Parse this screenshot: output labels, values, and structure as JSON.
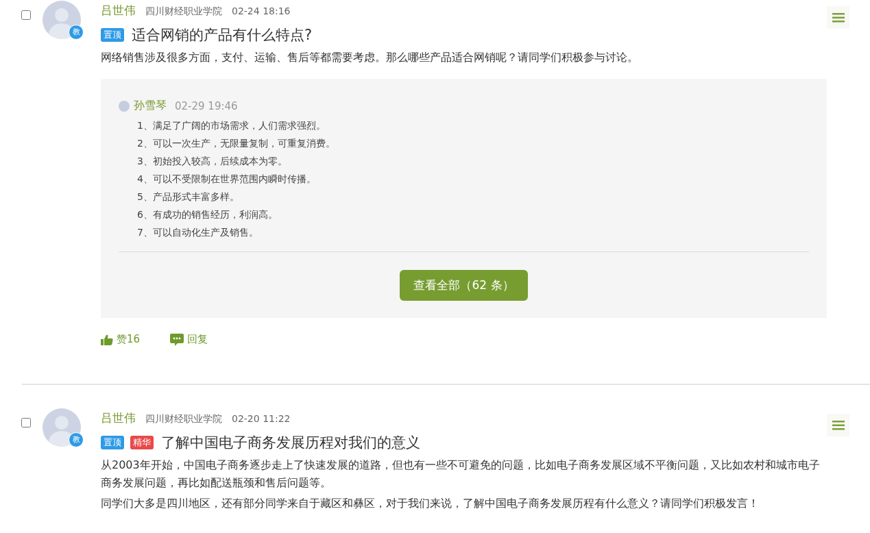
{
  "posts": [
    {
      "checked": false,
      "avatar_badge": "教",
      "author": "吕世伟",
      "school": "四川财经职业学院",
      "time": "02-24 18:16",
      "tags": [
        {
          "kind": "top",
          "label": "置顶"
        }
      ],
      "title": "适合网销的产品有什么特点?",
      "paragraphs": [
        "网络销售涉及很多方面，支付、运输、售后等都需要考虑。那么哪些产品适合网销呢？请同学们积极参与讨论。"
      ],
      "reply": {
        "author": "孙雪琴",
        "time": "02-29 19:46",
        "lines": [
          "1、满足了广阔的市场需求，人们需求强烈。",
          "2、可以一次生产，无限量复制，可重复消费。",
          "3、初始投入较高，后续成本为零。",
          "4、可以不受限制在世界范围内瞬时传播。",
          "5、产品形式丰富多样。",
          "6、有成功的销售经历，利润高。",
          "7、可以自动化生产及销售。"
        ],
        "view_all": "查看全部（62 条）"
      },
      "like": "赞16",
      "reply_label": "回复"
    },
    {
      "checked": false,
      "avatar_badge": "教",
      "author": "吕世伟",
      "school": "四川财经职业学院",
      "time": "02-20 11:22",
      "tags": [
        {
          "kind": "top",
          "label": "置顶"
        },
        {
          "kind": "essence",
          "label": "精华"
        }
      ],
      "title": "了解中国电子商务发展历程对我们的意义",
      "paragraphs": [
        "从2003年开始，中国电子商务逐步走上了快速发展的道路，但也有一些不可避免的问题，比如电子商务发展区域不平衡问题，又比如农村和城市电子商务发展问题，再比如配送瓶颈和售后问题等。",
        "同学们大多是四川地区，还有部分同学来自于藏区和彝区，对于我们来说，了解中国电子商务发展历程有什么意义？请同学们积极发言！"
      ]
    }
  ]
}
